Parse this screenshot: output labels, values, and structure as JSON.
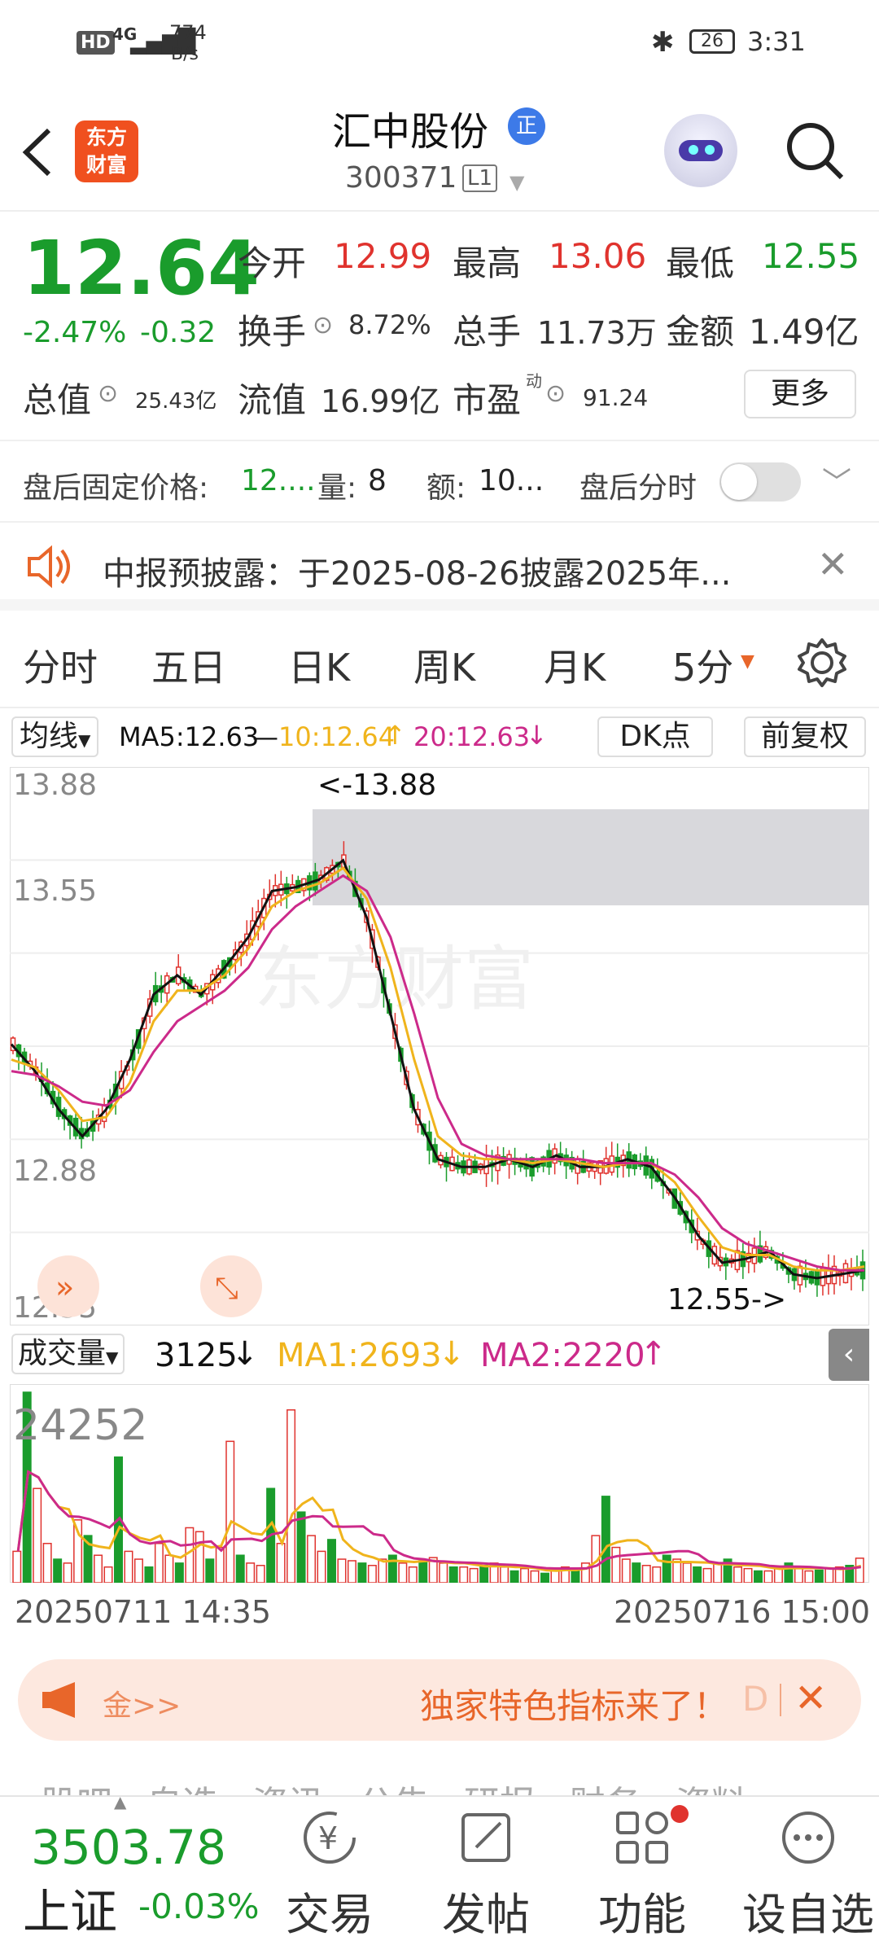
{
  "status_bar": {
    "hd": "HD",
    "network": "4G",
    "speed_value": "774",
    "speed_unit": "B/s",
    "battery": "26",
    "time": "3:31"
  },
  "header": {
    "logo_line1": "东方",
    "logo_line2": "财富",
    "title": "汇中股份",
    "badge": "正",
    "code": "300371",
    "level": "L1"
  },
  "quote": {
    "price": "12.64",
    "change_pct": "-2.47%",
    "change": "-0.32",
    "open_label": "今开",
    "open": "12.99",
    "high_label": "最高",
    "high": "13.06",
    "low_label": "最低",
    "low": "12.55",
    "turnover_label": "换手",
    "turnover": "8.72%",
    "volume_label": "总手",
    "volume": "11.73万",
    "amount_label": "金额",
    "amount": "1.49亿",
    "mktcap_label": "总值",
    "mktcap": "25.43亿",
    "float_label": "流值",
    "float": "16.99亿",
    "pe_label": "市盈",
    "pe_sup": "动",
    "pe": "91.24",
    "more_button": "更多"
  },
  "after_hours": {
    "price_label": "盘后固定价格:",
    "price": "12....",
    "qty_label": "量:",
    "qty": "8",
    "amt_label": "额:",
    "amt": "10...",
    "timeshare_label": "盘后分时"
  },
  "notice": {
    "text": "中报预披露：于2025-08-26披露2025年..."
  },
  "tabs": [
    {
      "label": "分时",
      "active": false
    },
    {
      "label": "五日",
      "active": false
    },
    {
      "label": "日K",
      "active": false
    },
    {
      "label": "周K",
      "active": false
    },
    {
      "label": "月K",
      "active": false
    },
    {
      "label": "5分",
      "active": true
    }
  ],
  "indicator": {
    "selector": "均线",
    "ma5_label": "MA5:12.63",
    "ma10_label": "10:12.64",
    "ma20_label": "20:12.63",
    "dk_button": "DK点",
    "adjust_button": "前复权"
  },
  "chart_labels": {
    "y_top": "13.88",
    "y_mid": "13.55",
    "y_low": "12.88",
    "y_bottom": "12.55",
    "max_marker": "<-13.88",
    "min_marker": "12.55->",
    "watermark": "东方财富"
  },
  "volume": {
    "selector": "成交量",
    "current": "3125",
    "ma1_label": "MA1:2693",
    "ma2_label": "MA2:2220",
    "max_label": "24252",
    "start_time": "20250711 14:35",
    "end_time": "20250716 15:00"
  },
  "banner": {
    "left_text": "金>>",
    "right_text": "独家特色指标来了！",
    "cut_text": "D"
  },
  "bottom_nav": {
    "index_value": "3503.78",
    "index_name": "上证",
    "index_change": "-0.03%",
    "items": [
      {
        "label": "交易"
      },
      {
        "label": "发帖"
      },
      {
        "label": "功能"
      },
      {
        "label": "设自选"
      }
    ],
    "peek_tabs": "股吧   自选   资讯   公告   研报   财务   资料"
  },
  "colors": {
    "up": "#e0332e",
    "down": "#1a9c2c",
    "ma5": "#111111",
    "ma10": "#f0b41c",
    "ma20": "#cc2a8a",
    "accent": "#e8662a"
  },
  "chart_data": {
    "type": "line",
    "title": "",
    "ylim": [
      12.55,
      13.88
    ],
    "x_range": [
      "20250711 14:35",
      "20250716 15:00"
    ],
    "series": [
      {
        "name": "MA5",
        "values": [
          13.22,
          13.15,
          13.05,
          12.98,
          13.05,
          13.18,
          13.35,
          13.4,
          13.35,
          13.42,
          13.5,
          13.62,
          13.63,
          13.65,
          13.7,
          13.55,
          13.3,
          13.05,
          12.92,
          12.9,
          12.9,
          12.92,
          12.9,
          12.93,
          12.9,
          12.9,
          12.92,
          12.9,
          12.82,
          12.72,
          12.65,
          12.66,
          12.68,
          12.62,
          12.61,
          12.62,
          12.63
        ]
      },
      {
        "name": "10",
        "values": [
          13.18,
          13.16,
          13.1,
          13.02,
          13.03,
          13.12,
          13.28,
          13.36,
          13.36,
          13.4,
          13.47,
          13.58,
          13.62,
          13.64,
          13.68,
          13.6,
          13.42,
          13.18,
          12.98,
          12.93,
          12.92,
          12.92,
          12.91,
          12.92,
          12.91,
          12.9,
          12.91,
          12.91,
          12.86,
          12.77,
          12.69,
          12.67,
          12.67,
          12.64,
          12.63,
          12.63,
          12.64
        ]
      },
      {
        "name": "20",
        "values": [
          13.15,
          13.14,
          13.11,
          13.07,
          13.06,
          13.1,
          13.2,
          13.28,
          13.32,
          13.36,
          13.42,
          13.52,
          13.58,
          13.62,
          13.66,
          13.62,
          13.5,
          13.3,
          13.08,
          12.96,
          12.93,
          12.92,
          12.92,
          12.92,
          12.92,
          12.91,
          12.91,
          12.91,
          12.88,
          12.82,
          12.74,
          12.7,
          12.68,
          12.66,
          12.64,
          12.63,
          12.63
        ]
      }
    ],
    "volume": {
      "max": 24252,
      "current": 3125,
      "ma1": 2693,
      "ma2": 2220,
      "values": [
        4000,
        24252,
        12000,
        5000,
        3000,
        2500,
        8000,
        6000,
        3500,
        2000,
        16000,
        4000,
        3000,
        2000,
        5000,
        3500,
        2500,
        7000,
        6500,
        3000,
        4500,
        18000,
        3500,
        2500,
        2200,
        12000,
        5000,
        22000,
        9000,
        6000,
        4000,
        5500,
        3000,
        2800,
        2500,
        2200,
        3000,
        3500,
        2500,
        2000,
        2800,
        3200,
        2500,
        2000,
        2000,
        1800,
        2200,
        2500,
        2000,
        1500,
        1800,
        1500,
        1200,
        1600,
        2000,
        1800,
        2500,
        6000,
        11000,
        4500,
        3000,
        2500,
        2200,
        2000,
        3500,
        3000,
        2500,
        2000,
        1800,
        2500,
        3000,
        2000,
        1800,
        1500,
        1500,
        2000,
        2500,
        1800,
        1500,
        1600,
        1800,
        2000,
        2200,
        3125
      ]
    }
  }
}
